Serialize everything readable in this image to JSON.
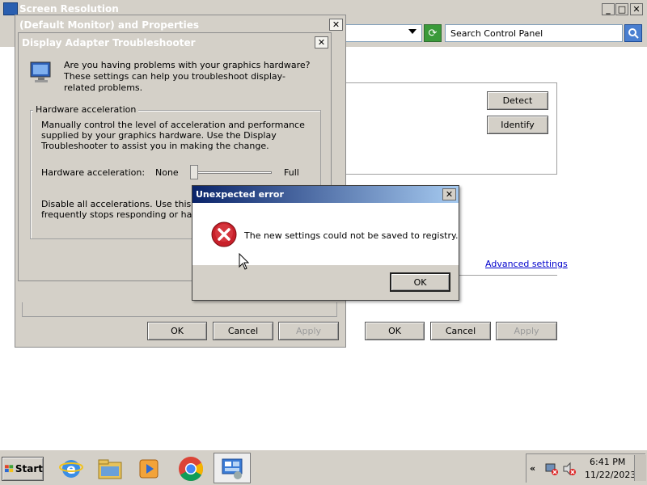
{
  "main_window": {
    "title": "Screen Resolution",
    "controls": [
      "_",
      "□",
      "✕"
    ],
    "search_placeholder": "Search Control Panel",
    "detect": "Detect",
    "identify": "Identify",
    "advanced_settings": "Advanced settings",
    "ok": "OK",
    "cancel": "Cancel",
    "apply": "Apply"
  },
  "properties_window": {
    "title": "(Default Monitor) and  Properties"
  },
  "troubleshooter": {
    "title": "Display Adapter Troubleshooter",
    "intro": "Are you having problems with your graphics hardware? These settings can help you troubleshoot display-related problems.",
    "group_title": "Hardware acceleration",
    "group_desc": "Manually control the level of acceleration and performance supplied by your graphics hardware. Use the Display Troubleshooter to assist you in making the change.",
    "slider_label": "Hardware acceleration:",
    "slider_min": "None",
    "slider_max": "Full",
    "slider_value": 0,
    "disable_text_1": "Disable all accelerations. Use this setting",
    "disable_text_2": "frequently stops responding or has oth",
    "ok": "OK",
    "cancel": "Cancel",
    "apply": "Apply"
  },
  "error_dialog": {
    "title": "Unexpected error",
    "message": "The new settings could not be saved to registry.",
    "ok": "OK"
  },
  "taskbar": {
    "start": "Start",
    "time": "6:41 PM",
    "date": "11/22/2023",
    "tray_expand": "«"
  },
  "colors": {
    "active_title": "#0a246a",
    "active_title_end": "#a6caf0",
    "face": "#d4d0c8",
    "error_red": "#c8202a",
    "link": "#0000cc"
  }
}
